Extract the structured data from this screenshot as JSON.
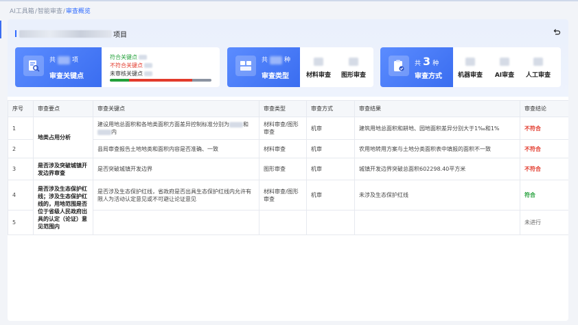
{
  "breadcrumb": {
    "items": [
      "AI工具箱",
      "智能审查"
    ],
    "current": "审查概览",
    "separator": "/"
  },
  "project": {
    "title_suffix": "项目"
  },
  "summary": {
    "key_points": {
      "label": "审查关键点",
      "unit": "项",
      "legend": [
        {
          "label": "符合关键点",
          "color": "#23a03a"
        },
        {
          "label": "不符合关键点",
          "color": "#e23a2c"
        },
        {
          "label": "未审核关键点",
          "color": "#333333"
        }
      ]
    },
    "review_types": {
      "label": "审查类型",
      "unit": "种",
      "items": [
        "材料审查",
        "图形审查"
      ]
    },
    "review_methods": {
      "label": "审查方式",
      "prefix": "共",
      "count": "3",
      "unit": "种",
      "items": [
        "机器审查",
        "AI审查",
        "人工审查"
      ]
    },
    "prefix": "共"
  },
  "table": {
    "headers": [
      "序号",
      "审查要点",
      "审查关键点",
      "审查类型",
      "审查方式",
      "审查结果",
      "审查结论"
    ],
    "rows": [
      {
        "no": "1",
        "key": "建设用地总面积和各地类面积方面差异控制标准分别为",
        "key_tail": "和",
        "key_line2_tail": "内",
        "type": "材料审查/图形审查",
        "method": "机审",
        "result": "建筑用地总面积和耕地、园地面积差异分别大于1‰和1%",
        "conclusion": "不符合"
      },
      {
        "no": "2",
        "key": "县局审查报告土地地类和面积内容是否准确、一致",
        "type": "材料审查",
        "method": "机审",
        "result": "农用地转用方案与土地分类面积表中填报的面积不一致",
        "conclusion": "不符合"
      },
      {
        "no": "3",
        "key": "是否突破城镇开发边界",
        "type": "图形审查",
        "method": "机审",
        "result": "城镇开发边界突破总面积602298.40平方米",
        "conclusion": "不符合"
      },
      {
        "no": "4",
        "key": "是否涉及生态保护红线，省政府是否出具生态保护红线内允许有限人为活动认定意见或不可避让论证意见",
        "type": "材料审查/图形审查",
        "method": "机审",
        "result": "未涉及生态保护红线",
        "conclusion": "符合"
      },
      {
        "no": "5",
        "key": "",
        "type": "",
        "method": "",
        "result": "",
        "conclusion": "未进行"
      }
    ],
    "groups": {
      "g1": "地类占用分析",
      "g2": "是否涉及突破城镇开发边界审查",
      "g3": "是否涉及生态保护红线；涉及生态保护红线的，用地范围是否位于省级人民政府出具的认定（论证）意见范围内"
    }
  },
  "colors": {
    "accent": "#2f6bff",
    "bad": "#e23a2c",
    "ok": "#23a03a"
  }
}
